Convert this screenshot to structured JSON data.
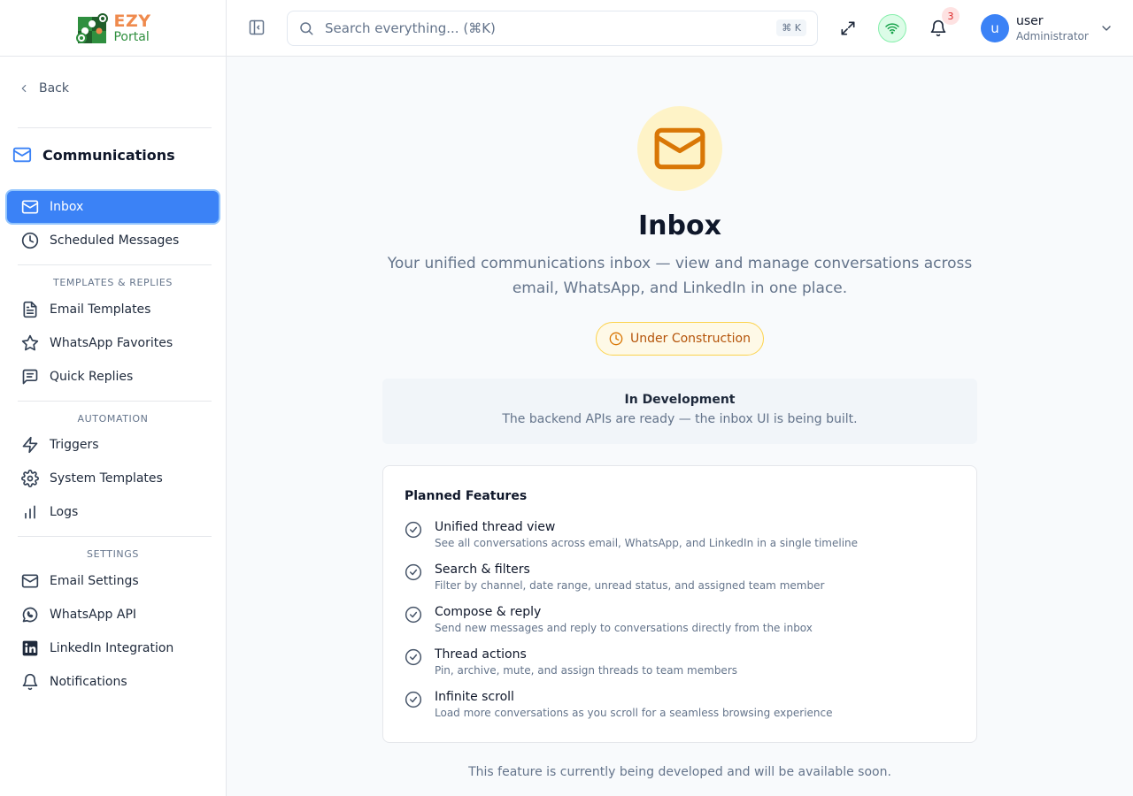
{
  "brand": {
    "name_top": "EZY",
    "name_bottom": "Portal",
    "colors": {
      "ezy": "#ef8a4d",
      "portal": "#2f8f3f"
    }
  },
  "sidebar": {
    "back_label": "Back",
    "section_title": "Communications",
    "primary_items": [
      {
        "label": "Inbox",
        "icon": "mail-icon",
        "active": true
      },
      {
        "label": "Scheduled Messages",
        "icon": "clock-icon",
        "active": false
      }
    ],
    "groups": [
      {
        "label": "TEMPLATES & REPLIES",
        "items": [
          {
            "label": "Email Templates",
            "icon": "document-icon"
          },
          {
            "label": "WhatsApp Favorites",
            "icon": "star-icon"
          },
          {
            "label": "Quick Replies",
            "icon": "message-square-icon"
          }
        ]
      },
      {
        "label": "AUTOMATION",
        "items": [
          {
            "label": "Triggers",
            "icon": "zap-icon"
          },
          {
            "label": "System Templates",
            "icon": "gear-icon"
          },
          {
            "label": "Logs",
            "icon": "bar-chart-icon"
          }
        ]
      },
      {
        "label": "SETTINGS",
        "items": [
          {
            "label": "Email Settings",
            "icon": "mail-icon"
          },
          {
            "label": "WhatsApp API",
            "icon": "whatsapp-icon"
          },
          {
            "label": "LinkedIn Integration",
            "icon": "linkedin-icon"
          },
          {
            "label": "Notifications",
            "icon": "bell-icon"
          }
        ]
      }
    ]
  },
  "header": {
    "search_placeholder": "Search everything... (⌘K)",
    "search_shortcut": "⌘ K",
    "notification_count": "3",
    "user": {
      "initial": "u",
      "name": "user",
      "role": "Administrator"
    }
  },
  "main": {
    "title": "Inbox",
    "description": "Your unified communications inbox — view and manage conversations across email, WhatsApp, and LinkedIn in one place.",
    "status_badge": "Under Construction",
    "dev_title": "In Development",
    "dev_text": "The backend APIs are ready — the inbox UI is being built.",
    "features_title": "Planned Features",
    "features": [
      {
        "name": "Unified thread view",
        "desc": "See all conversations across email, WhatsApp, and LinkedIn in a single timeline"
      },
      {
        "name": "Search & filters",
        "desc": "Filter by channel, date range, unread status, and assigned team member"
      },
      {
        "name": "Compose & reply",
        "desc": "Send new messages and reply to conversations directly from the inbox"
      },
      {
        "name": "Thread actions",
        "desc": "Pin, archive, mute, and assign threads to team members"
      },
      {
        "name": "Infinite scroll",
        "desc": "Load more conversations as you scroll for a seamless browsing experience"
      }
    ],
    "footer_note": "This feature is currently being developed and will be available soon."
  },
  "colors": {
    "accent": "#3b82f6",
    "warning": "#d97706",
    "warning_bg": "#fef3c7",
    "online": "#16a34a"
  }
}
